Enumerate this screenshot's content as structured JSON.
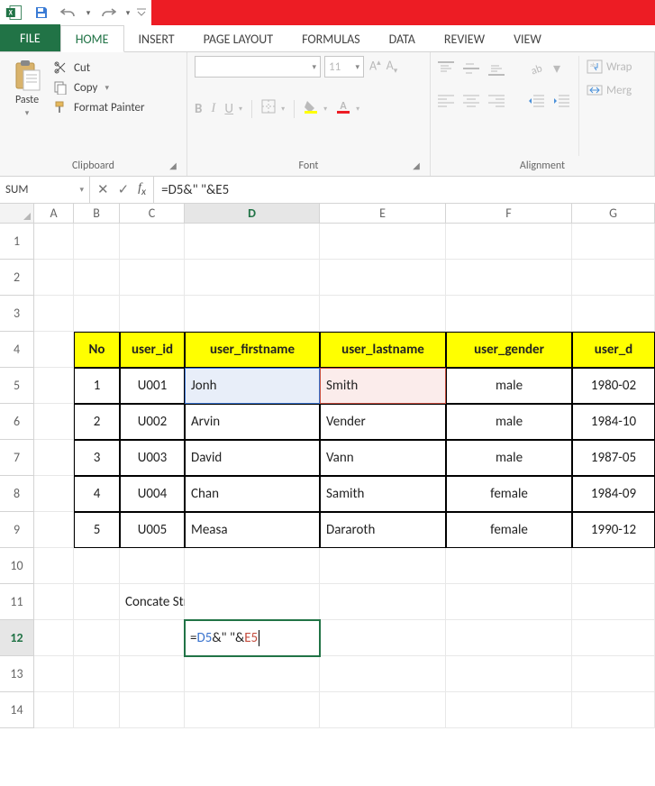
{
  "tabs": {
    "file": "FILE",
    "home": "HOME",
    "insert": "INSERT",
    "pagelayout": "PAGE LAYOUT",
    "formulas": "FORMULAS",
    "data": "DATA",
    "review": "REVIEW",
    "view": "VIEW"
  },
  "ribbon": {
    "clipboard": {
      "label": "Clipboard",
      "paste": "Paste",
      "cut": "Cut",
      "copy": "Copy",
      "fmtpaint": "Format Painter"
    },
    "font": {
      "label": "Font",
      "size": "11",
      "bold": "B",
      "italic": "I",
      "underline": "U"
    },
    "alignment": {
      "label": "Alignment",
      "wrap": "Wrap",
      "merge": "Merg"
    }
  },
  "fxbar": {
    "namebox": "SUM",
    "formula": "=D5&\" \"&E5"
  },
  "columns": [
    "A",
    "B",
    "C",
    "D",
    "E",
    "F",
    "G"
  ],
  "row_numbers": [
    "1",
    "2",
    "3",
    "4",
    "5",
    "6",
    "7",
    "8",
    "9",
    "10",
    "11",
    "12",
    "13",
    "14"
  ],
  "table": {
    "headers": [
      "No",
      "user_id",
      "user_firstname",
      "user_lastname",
      "user_gender",
      "user_d"
    ],
    "rows": [
      {
        "no": "1",
        "id": "U001",
        "first": "Jonh",
        "last": "Smith",
        "gender": "male",
        "dob": "1980-02"
      },
      {
        "no": "2",
        "id": "U002",
        "first": "Arvin",
        "last": "Vender",
        "gender": "male",
        "dob": "1984-10"
      },
      {
        "no": "3",
        "id": "U003",
        "first": "David",
        "last": "Vann",
        "gender": "male",
        "dob": "1987-05"
      },
      {
        "no": "4",
        "id": "U004",
        "first": "Chan",
        "last": "Samith",
        "gender": "female",
        "dob": "1984-09"
      },
      {
        "no": "5",
        "id": "U005",
        "first": "Measa",
        "last": "Dararoth",
        "gender": "female",
        "dob": "1990-12"
      }
    ]
  },
  "row11_text": "Concate String",
  "editing_formula": {
    "prefix": "=",
    "ref1": "D5",
    "mid": "&\" \"&",
    "ref2": "E5"
  }
}
